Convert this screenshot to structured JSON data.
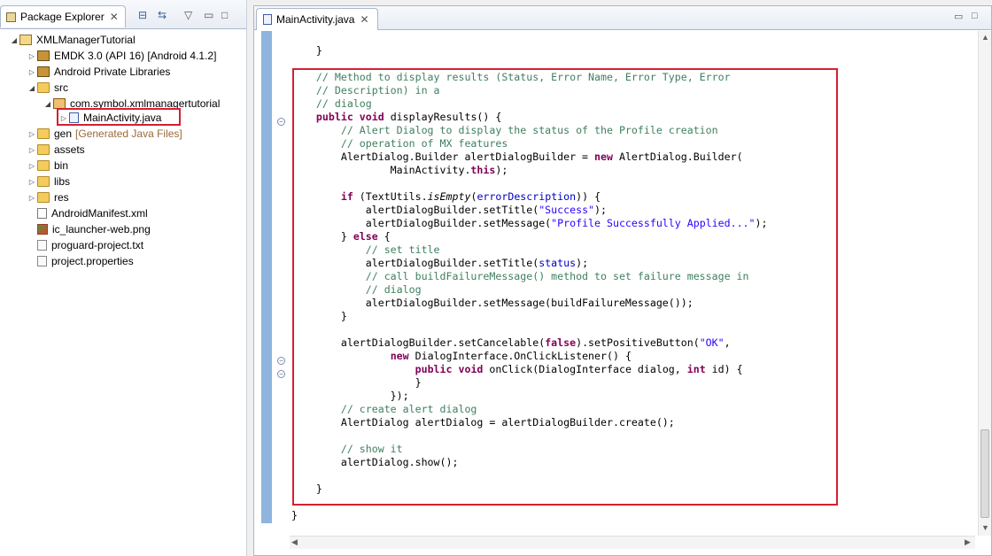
{
  "explorer": {
    "tab_label": "Package Explorer",
    "close_glyph": "✕",
    "tree": [
      {
        "label": "XMLManagerTutorial",
        "icon": "project-icon"
      },
      {
        "label": "EMDK 3.0 (API 16) [Android 4.1.2]",
        "icon": "library-icon"
      },
      {
        "label": "Android Private Libraries",
        "icon": "library-icon"
      },
      {
        "label": "src",
        "icon": "folder-icon"
      },
      {
        "label": "com.symbol.xmlmanagertutorial",
        "icon": "package-icon"
      },
      {
        "label": "MainActivity.java",
        "icon": "java-file-icon"
      },
      {
        "label": "gen",
        "suffix": "[Generated Java Files]",
        "icon": "folder-icon"
      },
      {
        "label": "assets",
        "icon": "folder-icon"
      },
      {
        "label": "bin",
        "icon": "folder-icon"
      },
      {
        "label": "libs",
        "icon": "folder-icon"
      },
      {
        "label": "res",
        "icon": "folder-icon"
      },
      {
        "label": "AndroidManifest.xml",
        "icon": "xml-file-icon"
      },
      {
        "label": "ic_launcher-web.png",
        "icon": "image-file-icon"
      },
      {
        "label": "proguard-project.txt",
        "icon": "text-file-icon"
      },
      {
        "label": "project.properties",
        "icon": "text-file-icon"
      }
    ]
  },
  "editor": {
    "tab_label": "MainActivity.java",
    "close_glyph": "✕",
    "lines": [
      "    }",
      "",
      "    // Method to display results (Status, Error Name, Error Type, Error",
      "    // Description) in a",
      "    // dialog",
      "    public void displayResults() {",
      "        // Alert Dialog to display the status of the Profile creation",
      "        // operation of MX features",
      "        AlertDialog.Builder alertDialogBuilder = new AlertDialog.Builder(",
      "                MainActivity.this);",
      "",
      "        if (TextUtils.isEmpty(errorDescription)) {",
      "            alertDialogBuilder.setTitle(\"Success\");",
      "            alertDialogBuilder.setMessage(\"Profile Successfully Applied...\");",
      "        } else {",
      "            // set title",
      "            alertDialogBuilder.setTitle(status);",
      "            // call buildFailureMessage() method to set failure message in",
      "            // dialog",
      "            alertDialogBuilder.setMessage(buildFailureMessage());",
      "        }",
      "",
      "        alertDialogBuilder.setCancelable(false).setPositiveButton(\"OK\",",
      "                new DialogInterface.OnClickListener() {",
      "                    public void onClick(DialogInterface dialog, int id) {",
      "                    }",
      "                });",
      "        // create alert dialog",
      "        AlertDialog alertDialog = alertDialogBuilder.create();",
      "",
      "        // show it",
      "        alertDialog.show();",
      "",
      "    }",
      "",
      "}"
    ]
  }
}
